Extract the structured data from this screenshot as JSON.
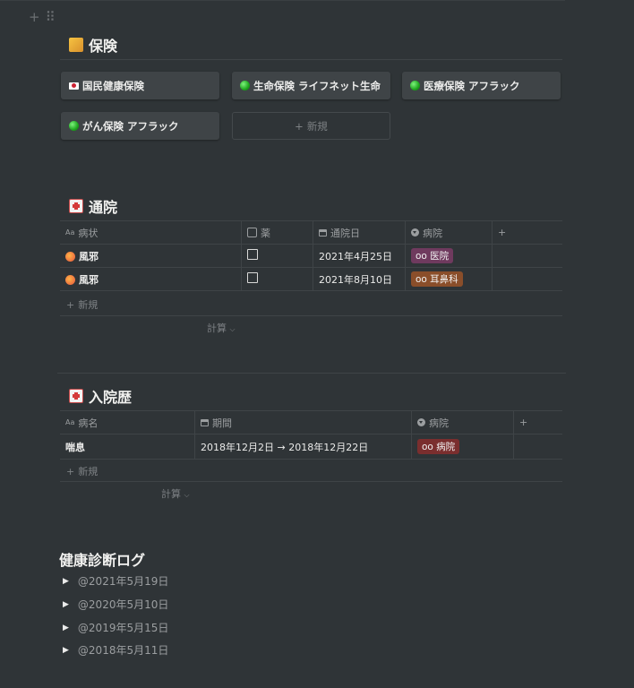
{
  "insurance": {
    "title": "保険",
    "cards": [
      "国民健康保険",
      "生命保険 ライフネット生命",
      "医療保険 アフラック",
      "がん保険 アフラック"
    ],
    "new_label": "新規"
  },
  "visits": {
    "title": "通院",
    "columns": [
      "病状",
      "薬",
      "通院日",
      "病院"
    ],
    "rows": [
      {
        "condition": "風邪",
        "date": "2021年4月25日",
        "hospital": "oo 医院",
        "hospital_color": "#6f3a5e"
      },
      {
        "condition": "風邪",
        "date": "2021年8月10日",
        "hospital": "oo 耳鼻科",
        "hospital_color": "#8a4e2a"
      }
    ],
    "new_label": "新規",
    "calc_label": "計算"
  },
  "hospitalization": {
    "title": "入院歴",
    "columns": [
      "病名",
      "期間",
      "病院"
    ],
    "rows": [
      {
        "disease": "喘息",
        "period": "2018年12月2日 → 2018年12月22日",
        "hospital": "oo 病院",
        "hospital_color": "#7a2e2e"
      }
    ],
    "new_label": "新規",
    "calc_label": "計算"
  },
  "checkup": {
    "title": "健康診断ログ",
    "entries": [
      "@2021年5月19日",
      "@2020年5月10日",
      "@2019年5月15日",
      "@2018年5月11日"
    ]
  }
}
